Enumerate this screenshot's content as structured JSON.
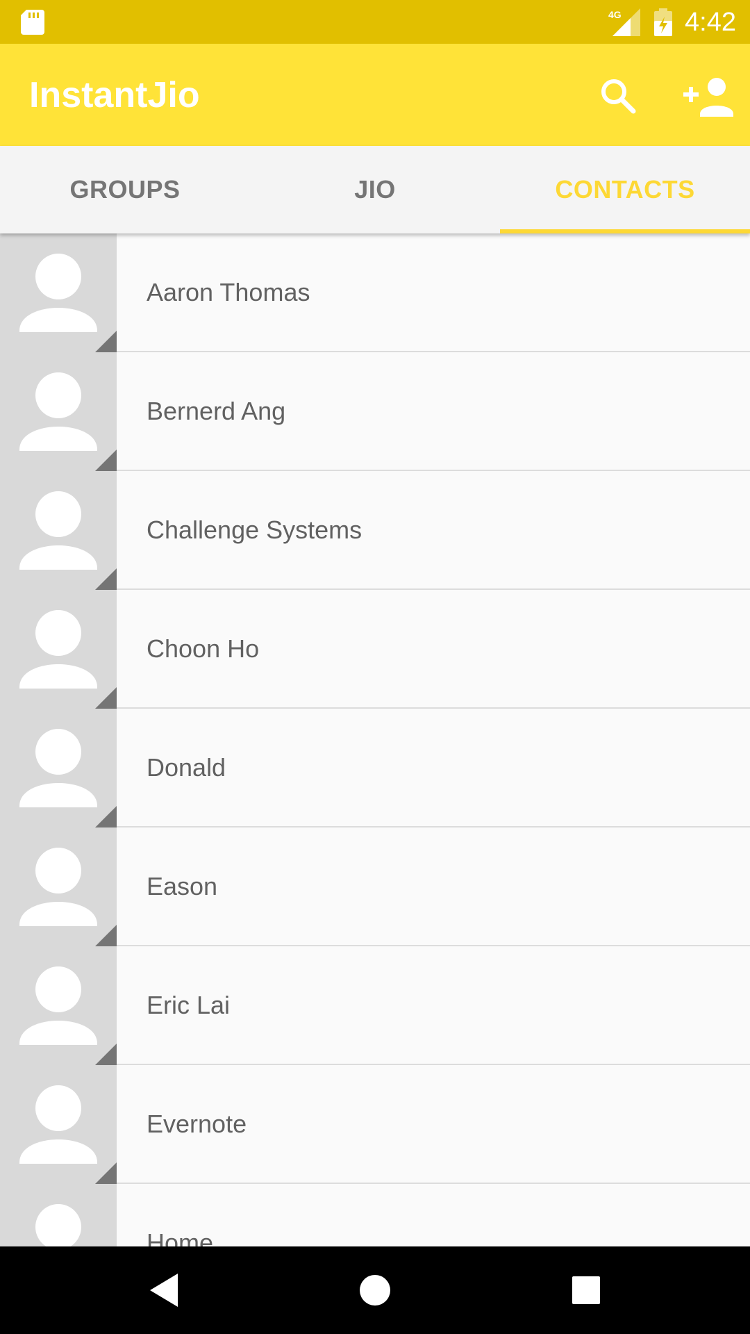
{
  "status_bar": {
    "time": "4:42",
    "network": "4G",
    "icons": [
      "sd-card-icon",
      "signal-icon",
      "battery-charging-icon"
    ]
  },
  "app_bar": {
    "title": "InstantJio",
    "actions": [
      "search-icon",
      "add-person-icon"
    ]
  },
  "tabs": [
    {
      "label": "GROUPS",
      "active": false
    },
    {
      "label": "JIO",
      "active": false
    },
    {
      "label": "CONTACTS",
      "active": true
    }
  ],
  "contacts": [
    {
      "name": "Aaron Thomas"
    },
    {
      "name": "Bernerd Ang"
    },
    {
      "name": "Challenge Systems"
    },
    {
      "name": "Choon Ho"
    },
    {
      "name": "Donald"
    },
    {
      "name": "Eason"
    },
    {
      "name": "Eric Lai"
    },
    {
      "name": "Evernote"
    },
    {
      "name": "Home"
    }
  ],
  "nav_bar": {
    "buttons": [
      "back-icon",
      "home-icon",
      "recents-icon"
    ]
  },
  "colors": {
    "status_bar": "#e1bf00",
    "app_bar": "#ffe338",
    "accent": "#fdd835",
    "tab_bar": "#f4f4f4",
    "avatar_bg": "#d9d9d9"
  }
}
